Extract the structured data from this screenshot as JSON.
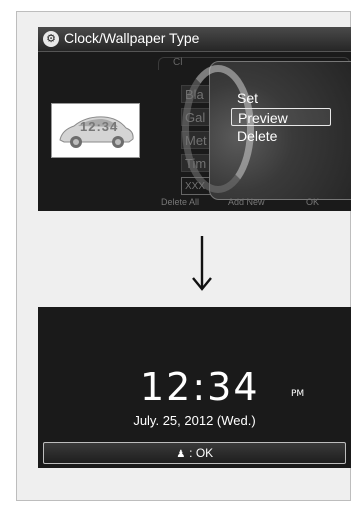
{
  "top_screen": {
    "title": "Clock/Wallpaper Type",
    "background_tab_label": "Cl",
    "background_list": [
      "Bla",
      "Gal",
      "Met",
      "Tim",
      "XXX"
    ],
    "thumbnail_clock": "12:34",
    "popup_menu": {
      "items": [
        "Set",
        "Preview",
        "Delete"
      ],
      "selected": "Preview"
    },
    "softkeys": [
      "Delete All",
      "Add New",
      "OK"
    ]
  },
  "bottom_screen": {
    "time": "12:34",
    "ampm": "PM",
    "date": "July. 25, 2012 (Wed.)",
    "ok_bar": {
      "icon": "dial-icon",
      "label": ": OK"
    }
  },
  "colors": {
    "screen_bg": "#1a1a1a",
    "frame_bg": "#efefef",
    "text": "#ffffff"
  }
}
